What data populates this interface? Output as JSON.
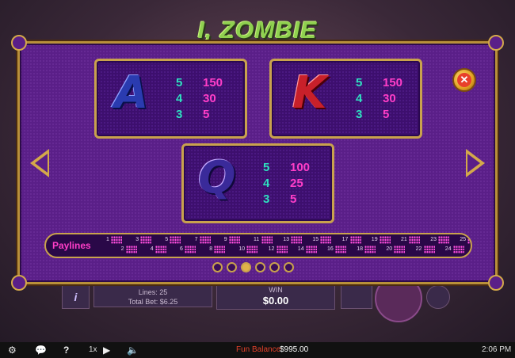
{
  "game": {
    "logo_text": "I, ZOMBIE"
  },
  "controls": {
    "info_icon": "i",
    "lines_label": "Lines: 25",
    "total_bet_label": "Total Bet: $6.25",
    "win_label": "WIN",
    "win_value": "$0.00"
  },
  "paytable": {
    "symbols": [
      {
        "symbol": "A",
        "pays": [
          {
            "count": "5",
            "amount": "150"
          },
          {
            "count": "4",
            "amount": "30"
          },
          {
            "count": "3",
            "amount": "5"
          }
        ]
      },
      {
        "symbol": "K",
        "pays": [
          {
            "count": "5",
            "amount": "150"
          },
          {
            "count": "4",
            "amount": "30"
          },
          {
            "count": "3",
            "amount": "5"
          }
        ]
      },
      {
        "symbol": "Q",
        "pays": [
          {
            "count": "5",
            "amount": "100"
          },
          {
            "count": "4",
            "amount": "25"
          },
          {
            "count": "3",
            "amount": "5"
          }
        ]
      }
    ],
    "close_icon": "close-icon"
  },
  "paylines": {
    "label": "Paylines",
    "numbers": [
      "1",
      "2",
      "3",
      "4",
      "5",
      "6",
      "7",
      "8",
      "9",
      "10",
      "11",
      "12",
      "13",
      "14",
      "15",
      "16",
      "17",
      "18",
      "19",
      "20",
      "21",
      "22",
      "23",
      "24",
      "25"
    ]
  },
  "pager": {
    "pages": 6,
    "active_index": 2
  },
  "status_bar": {
    "speed_label": "1x",
    "balance_label": "Fun Balance",
    "balance_value": "$995.00",
    "time": "2:06 PM"
  },
  "colors": {
    "panel": "#5a1f88",
    "gold_border": "#c9a24d",
    "count_color": "#2fe0c0",
    "amount_color": "#ff3ec8"
  }
}
